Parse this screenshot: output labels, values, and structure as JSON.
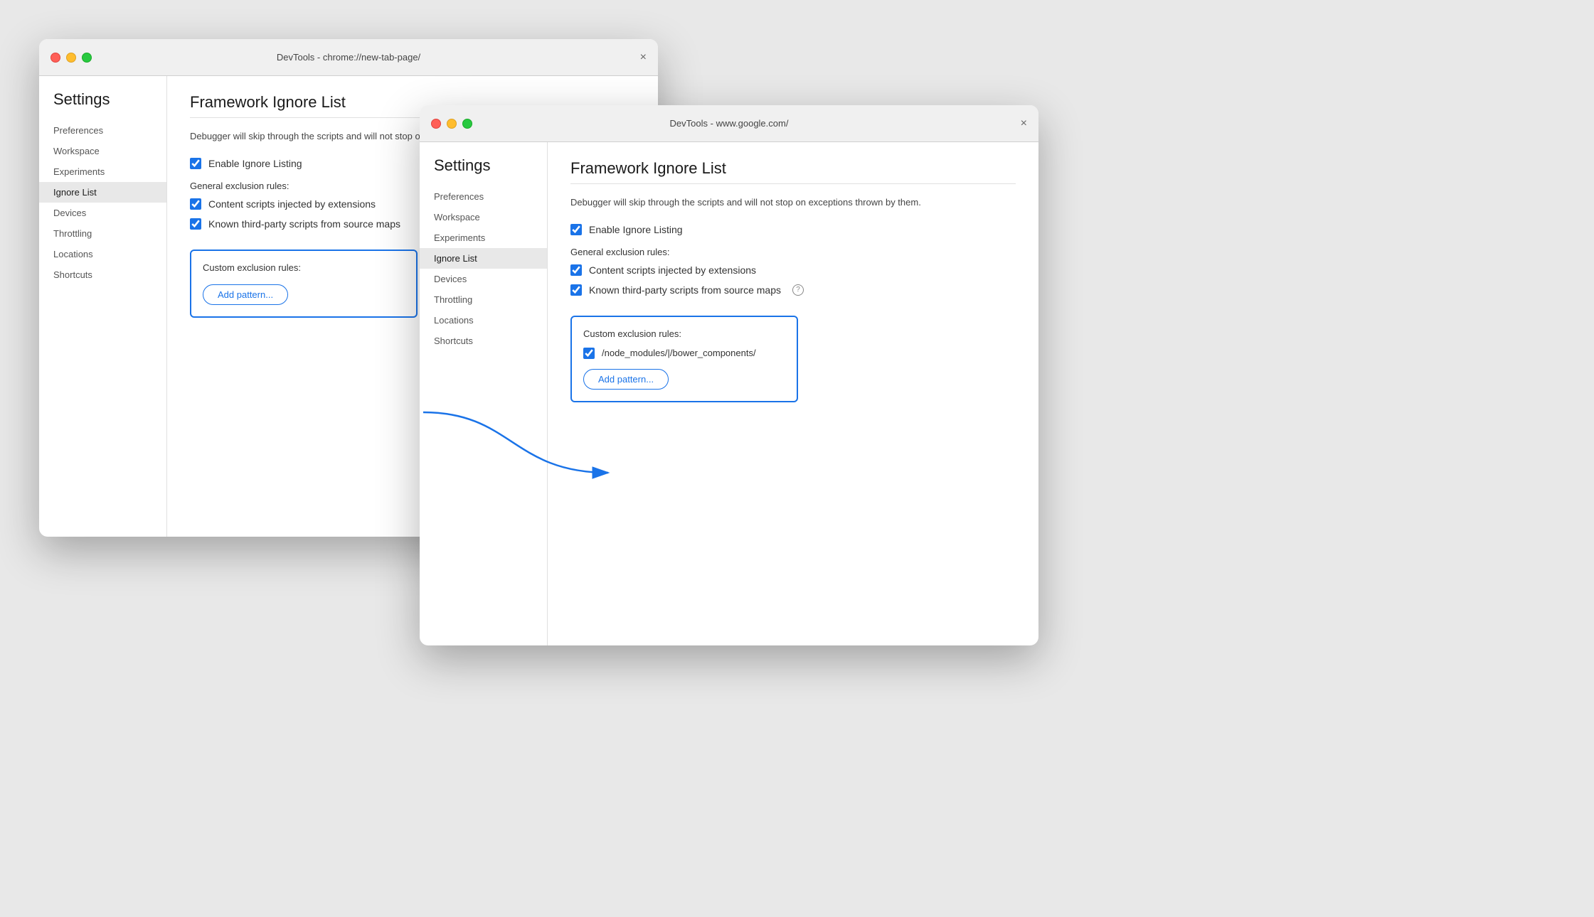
{
  "window1": {
    "title": "DevTools - chrome://new-tab-page/",
    "sidebar": {
      "heading": "Settings",
      "items": [
        {
          "label": "Preferences",
          "active": false
        },
        {
          "label": "Workspace",
          "active": false
        },
        {
          "label": "Experiments",
          "active": false
        },
        {
          "label": "Ignore List",
          "active": true
        },
        {
          "label": "Devices",
          "active": false
        },
        {
          "label": "Throttling",
          "active": false
        },
        {
          "label": "Locations",
          "active": false
        },
        {
          "label": "Shortcuts",
          "active": false
        }
      ]
    },
    "main": {
      "title": "Framework Ignore List",
      "description": "Debugger will skip through the scripts and will not stop on exceptions thrown by them.",
      "enable_label": "Enable Ignore Listing",
      "general_rules_label": "General exclusion rules:",
      "rule1": "Content scripts injected by extensions",
      "rule2": "Known third-party scripts from source maps",
      "custom_rules_label": "Custom exclusion rules:",
      "add_pattern_label": "Add pattern..."
    }
  },
  "window2": {
    "title": "DevTools - www.google.com/",
    "sidebar": {
      "heading": "Settings",
      "items": [
        {
          "label": "Preferences",
          "active": false
        },
        {
          "label": "Workspace",
          "active": false
        },
        {
          "label": "Experiments",
          "active": false
        },
        {
          "label": "Ignore List",
          "active": true
        },
        {
          "label": "Devices",
          "active": false
        },
        {
          "label": "Throttling",
          "active": false
        },
        {
          "label": "Locations",
          "active": false
        },
        {
          "label": "Shortcuts",
          "active": false
        }
      ]
    },
    "main": {
      "title": "Framework Ignore List",
      "description": "Debugger will skip through the scripts and will not stop on exceptions thrown by them.",
      "enable_label": "Enable Ignore Listing",
      "general_rules_label": "General exclusion rules:",
      "rule1": "Content scripts injected by extensions",
      "rule2": "Known third-party scripts from source maps",
      "custom_rules_label": "Custom exclusion rules:",
      "custom_rule1": "/node_modules/|/bower_components/",
      "add_pattern_label": "Add pattern..."
    }
  },
  "arrow": {
    "color": "#1a73e8"
  }
}
